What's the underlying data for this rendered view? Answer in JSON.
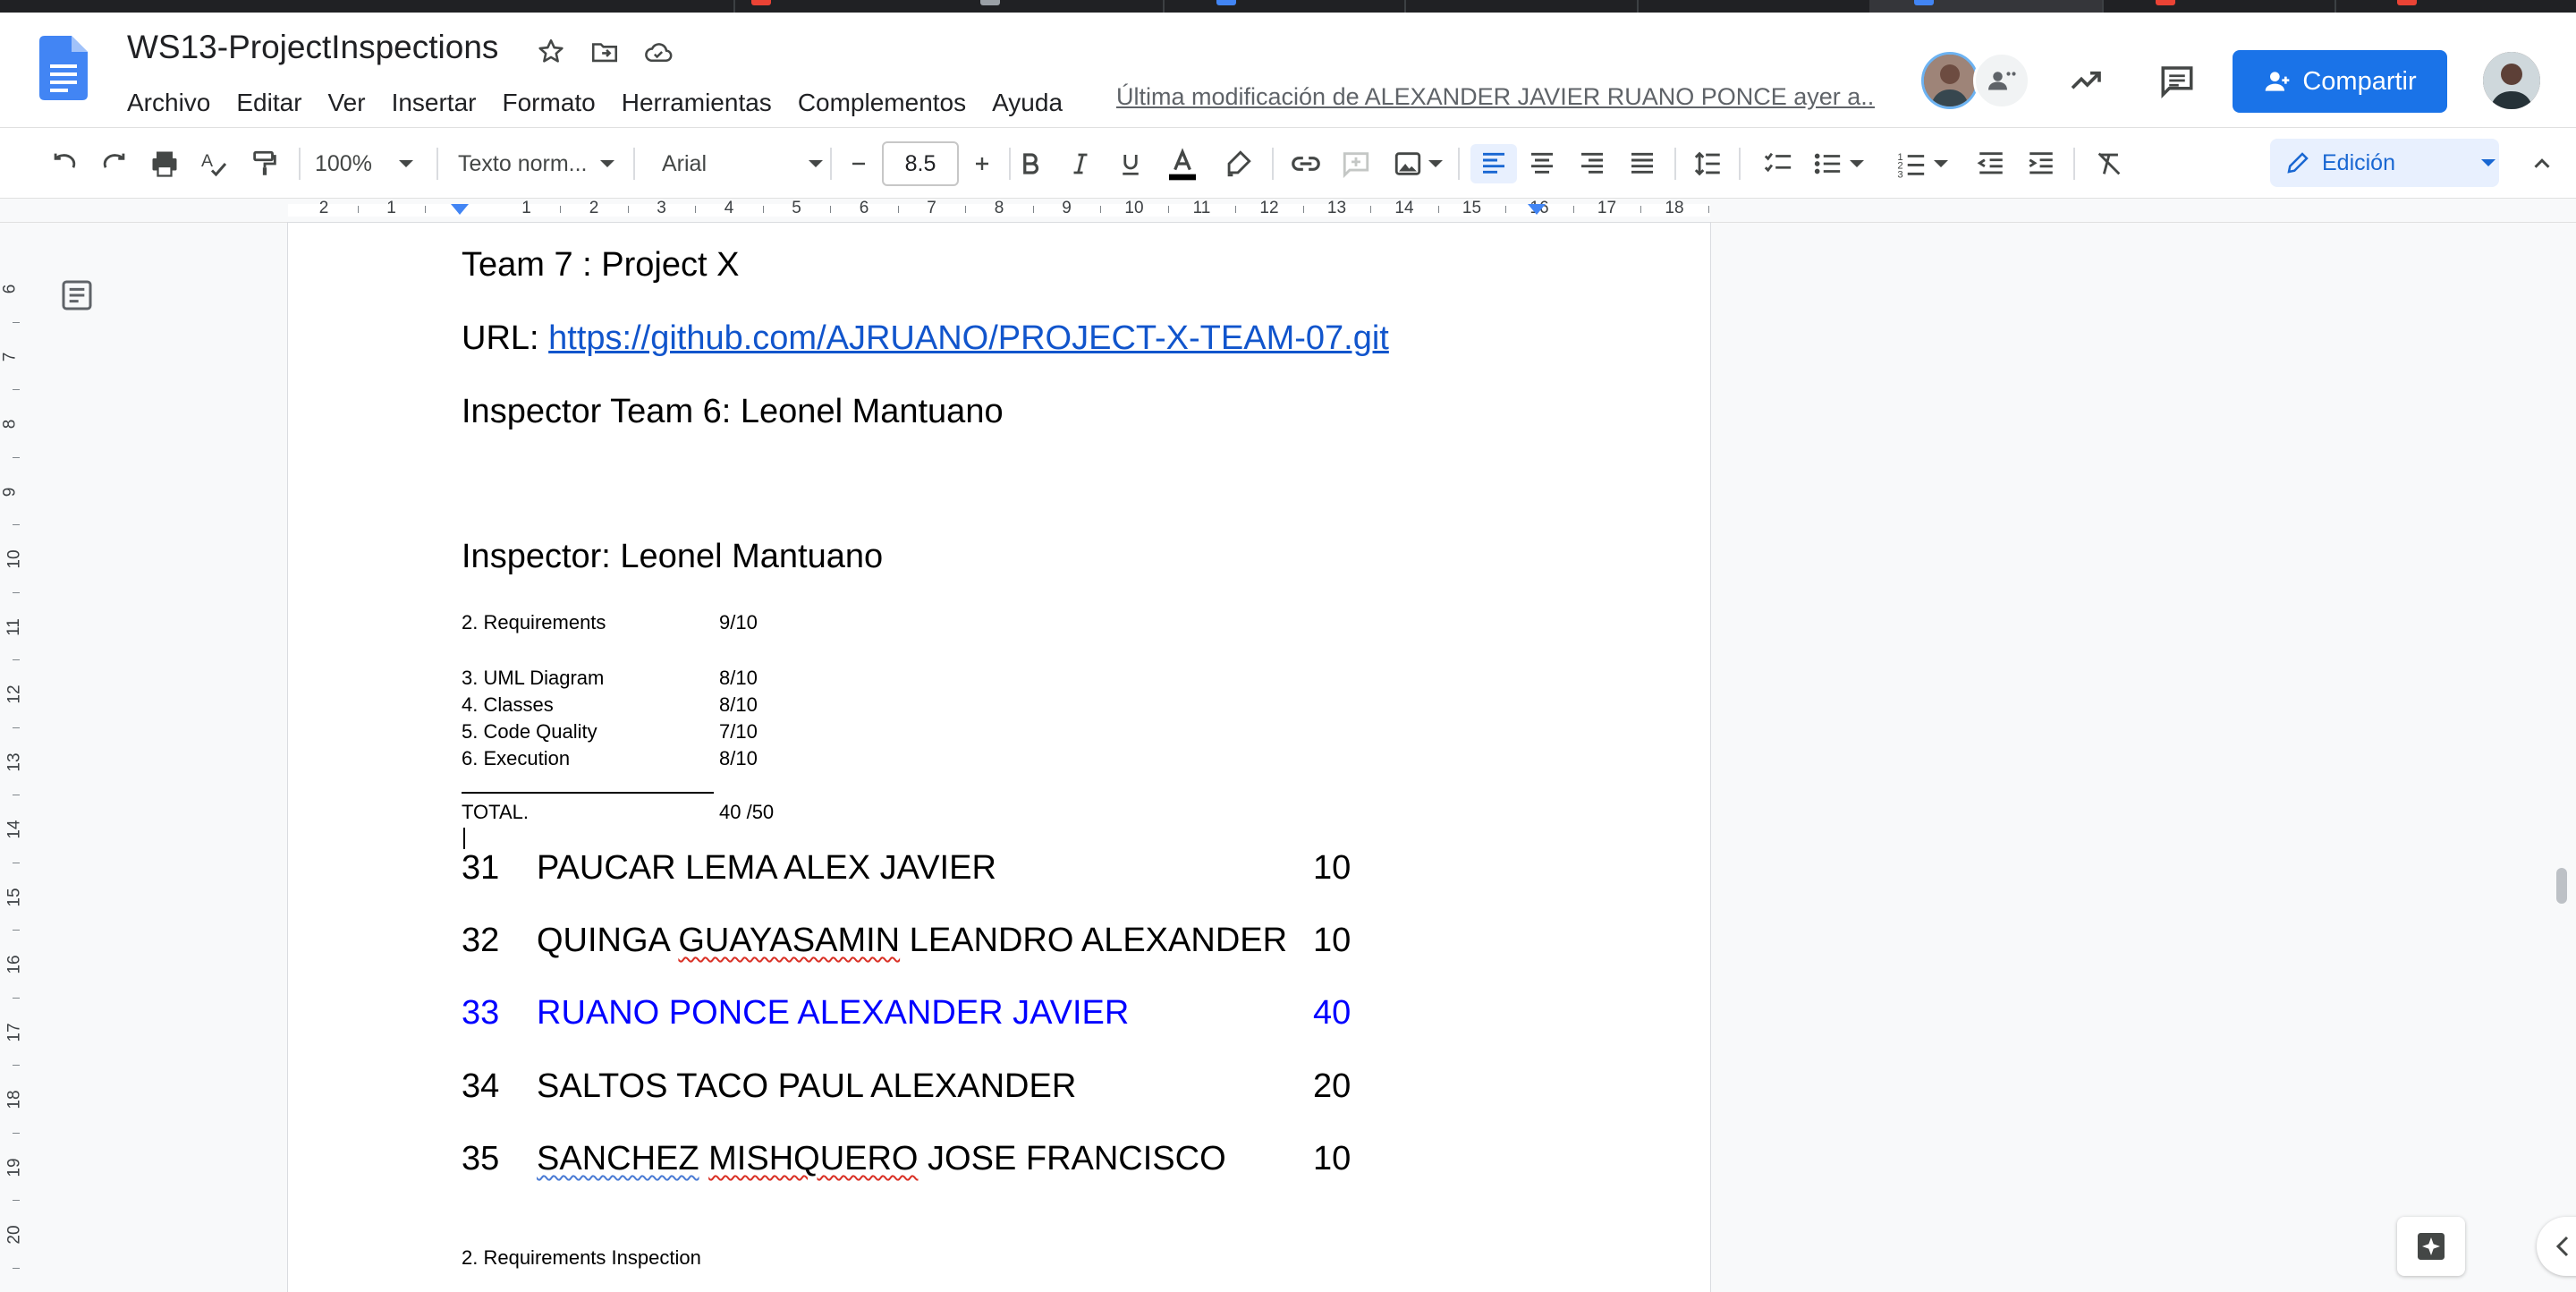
{
  "document": {
    "title": "WS13-ProjectInspections",
    "last_edit": "Última modificación de ALEXANDER JAVIER RUANO PONCE ayer a..."
  },
  "menu": [
    "Archivo",
    "Editar",
    "Ver",
    "Insertar",
    "Formato",
    "Herramientas",
    "Complementos",
    "Ayuda"
  ],
  "share_label": "Compartir",
  "toolbar": {
    "zoom": "100%",
    "style": "Texto norm...",
    "font": "Arial",
    "font_size": "8.5",
    "mode": "Edición"
  },
  "ruler": {
    "h_numbers": [
      "2",
      "1",
      "1",
      "2",
      "3",
      "4",
      "5",
      "6",
      "7",
      "8",
      "9",
      "10",
      "11",
      "12",
      "13",
      "14",
      "15",
      "16",
      "17",
      "18"
    ],
    "v_numbers": [
      "6",
      "7",
      "8",
      "9",
      "10",
      "11",
      "12",
      "13",
      "14",
      "15",
      "16",
      "17",
      "18",
      "19",
      "20"
    ]
  },
  "content": {
    "team_line": "Team 7 : Project X",
    "url_label": "URL: ",
    "url": "https://github.com/AJRUANO/PROJECT-X-TEAM-07.git",
    "inspector_team": "Inspector Team 6: Leonel Mantuano",
    "inspector": "Inspector: Leonel Mantuano",
    "scores": [
      {
        "label": "2. Requirements",
        "value": "9/10"
      },
      {
        "label": "3. UML Diagram",
        "value": "8/10"
      },
      {
        "label": "4. Classes",
        "value": "8/10"
      },
      {
        "label": "5. Code Quality",
        "value": "7/10"
      },
      {
        "label": "6. Execution",
        "value": "8/10"
      }
    ],
    "total_label": "TOTAL.",
    "total_value": "40 /50",
    "roster": [
      {
        "num": "31",
        "name": "PAUCAR LEMA ALEX JAVIER",
        "grade": "10"
      },
      {
        "num": "32",
        "name_parts": [
          "QUINGA ",
          "GUAYASAMIN",
          " LEANDRO ALEXANDER"
        ],
        "grade": "10"
      },
      {
        "num": "33",
        "name": "RUANO PONCE ALEXANDER JAVIER",
        "grade": "40"
      },
      {
        "num": "34",
        "name": "SALTOS TACO PAUL ALEXANDER",
        "grade": "20"
      },
      {
        "num": "35",
        "name_parts": [
          "SANCHEZ",
          " ",
          "MISHQUERO",
          " JOSE FRANCISCO"
        ],
        "grade": "10"
      }
    ],
    "footer_heading": "2. Requirements Inspection"
  },
  "colors": {
    "accent": "#1a73e8",
    "highlight_row": "#0000ff",
    "link": "#1155cc"
  }
}
